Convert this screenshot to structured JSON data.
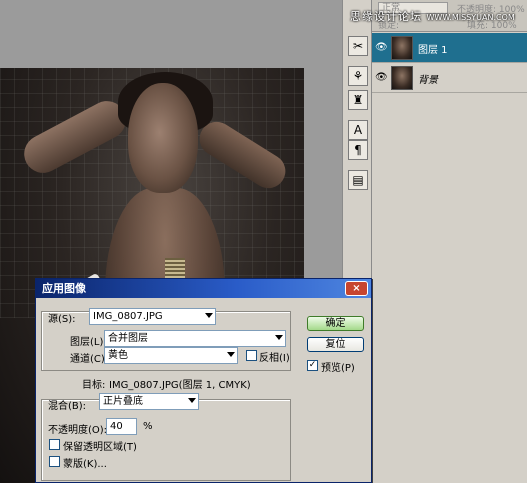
{
  "watermark": {
    "text": "思缘设计论坛",
    "site": "WWW.MISSYUAN.COM"
  },
  "layers_panel": {
    "blend_mode": "正常",
    "opacity_label": "不透明度: 100%",
    "lock_label": "锁定:",
    "fill_label": "填充: 100%",
    "layers": [
      {
        "name": "图层 1",
        "selected": true,
        "visible": true
      },
      {
        "name": "背景",
        "selected": false,
        "visible": true
      }
    ]
  },
  "tools": [
    {
      "icon": "tools-icon",
      "glyph": "✂"
    },
    {
      "icon": "channel-mixer-icon",
      "glyph": "⚘"
    },
    {
      "icon": "stamp-icon",
      "glyph": "♜"
    },
    {
      "icon": "character-icon",
      "glyph": "A"
    },
    {
      "icon": "paragraph-icon",
      "glyph": "¶"
    },
    {
      "icon": "info-panel-icon",
      "glyph": "▤"
    }
  ],
  "dialog": {
    "title": "应用图像",
    "close_glyph": "×",
    "source": {
      "label": "源(S):",
      "value": "IMG_0807.JPG",
      "layer_label": "图层(L):",
      "layer_value": "合并图层",
      "channel_label": "通道(C):",
      "channel_value": "黄色",
      "invert_label": "反相(I)",
      "invert_checked": false
    },
    "target_label": "目标:",
    "target_value": "IMG_0807.JPG(图层 1, CMYK)",
    "blending": {
      "label": "混合(B):",
      "value": "正片叠底",
      "opacity_label": "不透明度(O):",
      "opacity_value": "40",
      "opacity_unit": "%",
      "preserve_label": "保留透明区域(T)",
      "preserve_checked": false,
      "mask_label": "蒙版(K)...",
      "mask_checked": false
    },
    "ok_label": "确定",
    "reset_label": "复位",
    "preview_label": "预览(P)",
    "preview_checked": true
  }
}
